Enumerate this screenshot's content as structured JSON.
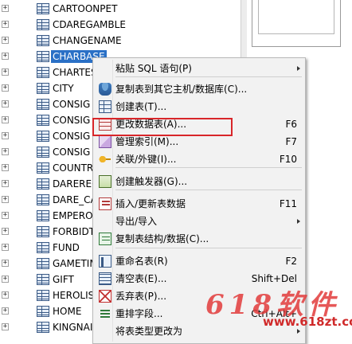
{
  "tree": {
    "items": [
      {
        "label": "CARTOONPET",
        "selected": false
      },
      {
        "label": "CDAREGAMBLE",
        "selected": false
      },
      {
        "label": "CHANGENAME",
        "selected": false
      },
      {
        "label": "CHARBASE",
        "selected": true
      },
      {
        "label": "CHARTES",
        "selected": false
      },
      {
        "label": "CITY",
        "selected": false
      },
      {
        "label": "CONSIG",
        "selected": false
      },
      {
        "label": "CONSIG",
        "selected": false
      },
      {
        "label": "CONSIG",
        "selected": false
      },
      {
        "label": "CONSIG",
        "selected": false
      },
      {
        "label": "COUNTR",
        "selected": false
      },
      {
        "label": "DAREREC",
        "selected": false
      },
      {
        "label": "DARE_CA",
        "selected": false
      },
      {
        "label": "EMPERO",
        "selected": false
      },
      {
        "label": "FORBIDT",
        "selected": false
      },
      {
        "label": "FUND",
        "selected": false
      },
      {
        "label": "GAMETIM",
        "selected": false
      },
      {
        "label": "GIFT",
        "selected": false
      },
      {
        "label": "HEROLIS",
        "selected": false
      },
      {
        "label": "HOME",
        "selected": false
      },
      {
        "label": "KINGNAI",
        "selected": false
      }
    ],
    "expander_glyph": "+"
  },
  "context_menu": {
    "items": [
      {
        "label": "粘贴 SQL 语句(P)",
        "shortcut": "",
        "icon": "none",
        "submenu": true
      },
      {
        "label": "复制表到其它主机/数据库(C)...",
        "shortcut": "",
        "icon": "database-copy-icon",
        "submenu": false
      },
      {
        "label": "创建表(T)...",
        "shortcut": "",
        "icon": "create-table-icon",
        "submenu": false
      },
      {
        "label": "更改数据表(A)...",
        "shortcut": "F6",
        "icon": "alter-table-icon",
        "submenu": false
      },
      {
        "label": "管理索引(M)...",
        "shortcut": "F7",
        "icon": "index-icon",
        "submenu": false
      },
      {
        "label": "关联/外键(I)...",
        "shortcut": "F10",
        "icon": "foreign-key-icon",
        "submenu": false
      },
      {
        "label": "创建触发器(G)...",
        "shortcut": "",
        "icon": "trigger-icon",
        "submenu": false
      },
      {
        "label": "插入/更新表数据",
        "shortcut": "F11",
        "icon": "insert-data-icon",
        "submenu": false
      },
      {
        "label": "导出/导入",
        "shortcut": "",
        "icon": "none",
        "submenu": true
      },
      {
        "label": "复制表结构/数据(C)...",
        "shortcut": "",
        "icon": "copy-structure-icon",
        "submenu": false
      },
      {
        "label": "重命名表(R)",
        "shortcut": "F2",
        "icon": "rename-table-icon",
        "submenu": false
      },
      {
        "label": "清空表(E)...",
        "shortcut": "Shift+Del",
        "icon": "empty-table-icon",
        "submenu": false
      },
      {
        "label": "丢弃表(P)...",
        "shortcut": "",
        "icon": "drop-table-icon",
        "submenu": false
      },
      {
        "label": "重排字段...",
        "shortcut": "Ctrl+Alt+",
        "icon": "reorder-fields-icon",
        "submenu": false
      },
      {
        "label": "将表类型更改为",
        "shortcut": "",
        "icon": "none",
        "submenu": true
      }
    ]
  },
  "watermark": {
    "big": "618软件",
    "url": "www.618zt.com"
  },
  "colors": {
    "selection": "#2a70c6",
    "highlight_border": "#d8262a",
    "watermark": "#e23b3b"
  }
}
